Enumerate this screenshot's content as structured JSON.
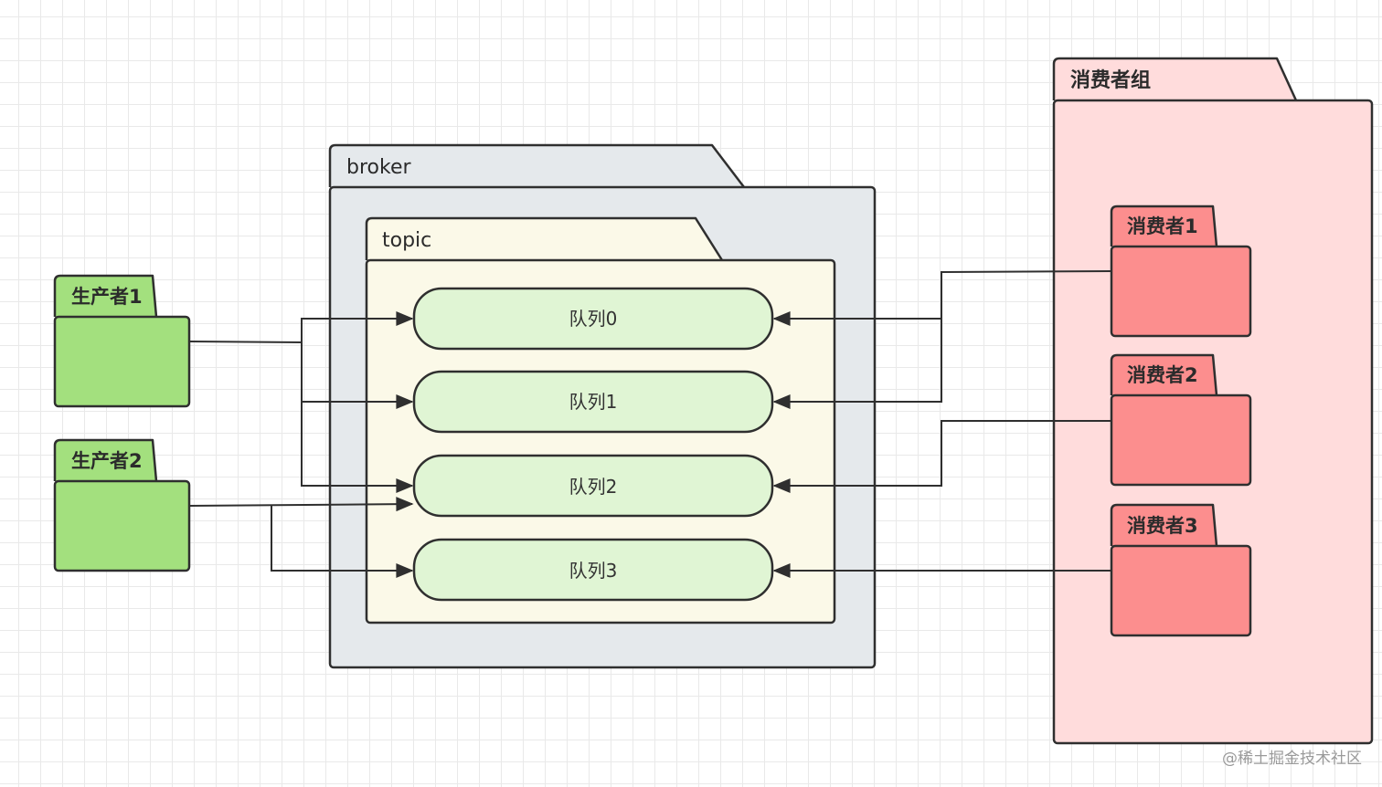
{
  "colors": {
    "stroke": "#2f2f2f",
    "producer_fill": "#a3e07e",
    "broker_fill": "#e5e9ec",
    "topic_fill": "#fbf9e8",
    "queue_fill": "#e0f5d4",
    "group_fill": "#ffdcdc",
    "consumer_fill": "#fc8e8e"
  },
  "producers": [
    {
      "label": "生产者1"
    },
    {
      "label": "生产者2"
    }
  ],
  "broker": {
    "label": "broker"
  },
  "topic": {
    "label": "topic"
  },
  "queues": [
    {
      "label": "队列0"
    },
    {
      "label": "队列1"
    },
    {
      "label": "队列2"
    },
    {
      "label": "队列3"
    }
  ],
  "consumer_group": {
    "label": "消费者组"
  },
  "consumers": [
    {
      "label": "消费者1"
    },
    {
      "label": "消费者2"
    },
    {
      "label": "消费者3"
    }
  ],
  "watermark": "@稀土掘金技术社区"
}
